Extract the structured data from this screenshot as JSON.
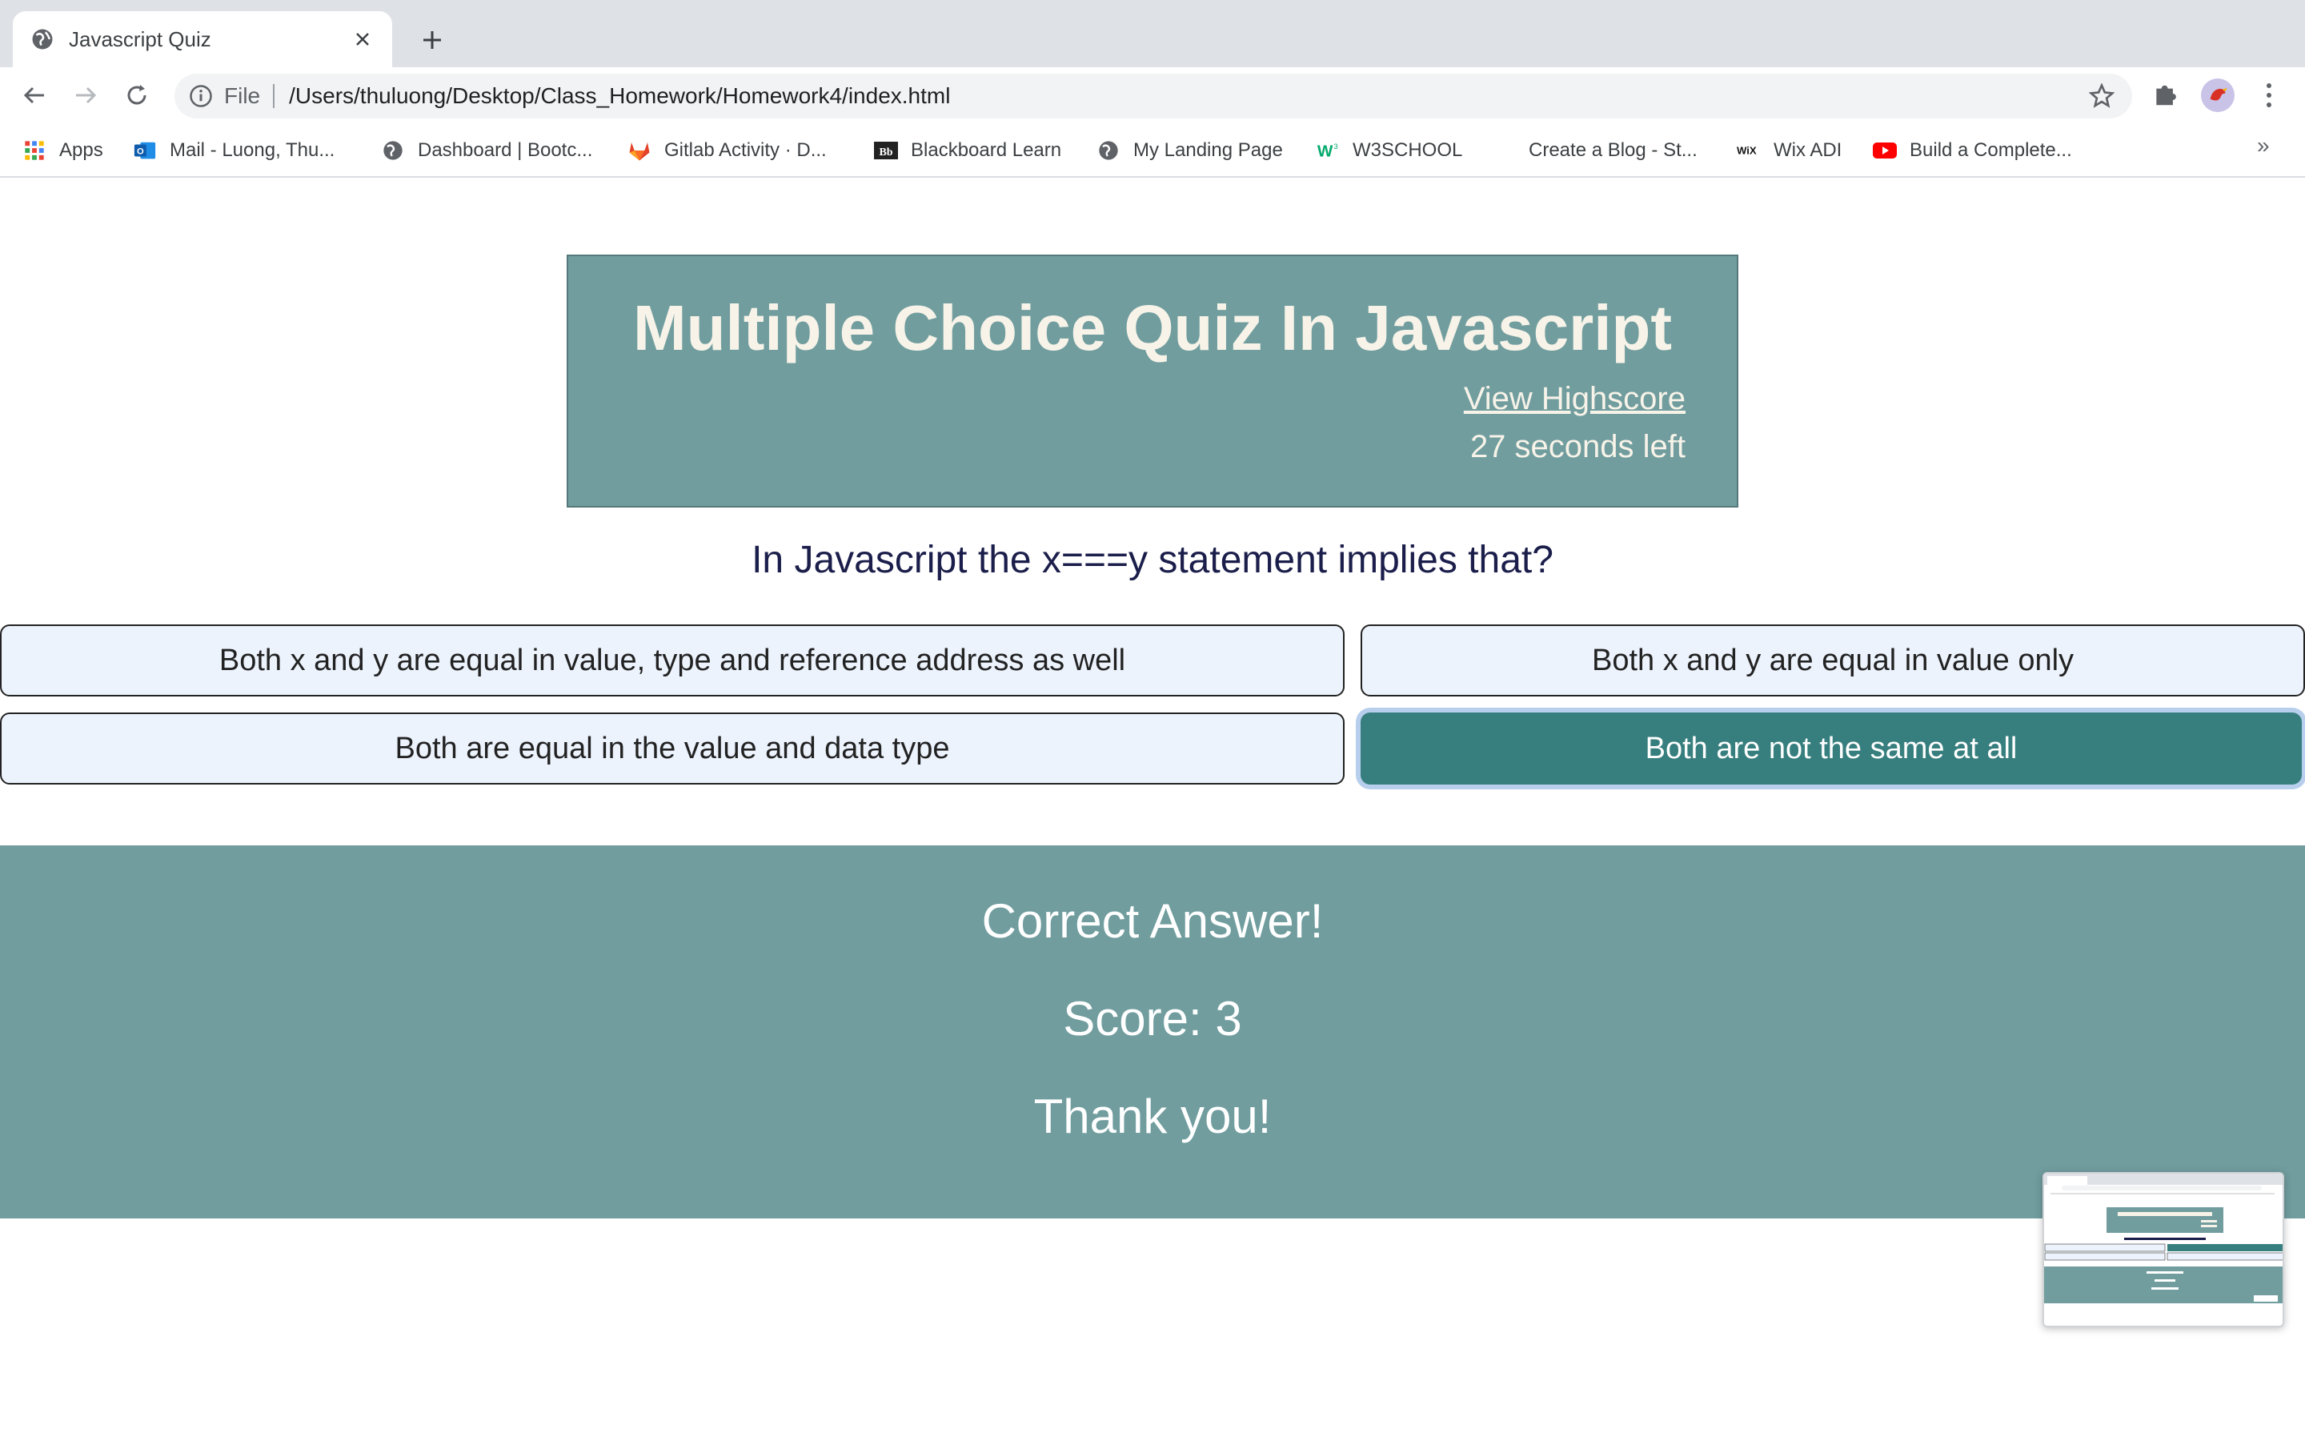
{
  "browser": {
    "tab_title": "Javascript Quiz",
    "url_scheme": "File",
    "url": "/Users/thuluong/Desktop/Class_Homework/Homework4/index.html",
    "bookmarks": [
      {
        "label": "Apps",
        "icon": "apps-grid-icon"
      },
      {
        "label": "Mail - Luong, Thu...",
        "icon": "outlook-icon"
      },
      {
        "label": "Dashboard | Bootc...",
        "icon": "globe-icon"
      },
      {
        "label": "Gitlab Activity · D...",
        "icon": "gitlab-icon"
      },
      {
        "label": "Blackboard Learn",
        "icon": "blackboard-icon"
      },
      {
        "label": "My Landing Page",
        "icon": "globe-icon"
      },
      {
        "label": "W3SCHOOL",
        "icon": "w3schools-icon"
      },
      {
        "label": "Create a Blog - St...",
        "icon": "blank"
      },
      {
        "label": "Wix ADI",
        "icon": "wix-icon"
      },
      {
        "label": "Build a Complete...",
        "icon": "youtube-icon"
      }
    ],
    "bookmarks_overflow": "»"
  },
  "quiz": {
    "title": "Multiple Choice Quiz In Javascript",
    "highscore_link": "View Highscore",
    "timer_text": "27 seconds left",
    "question": "In Javascript the x===y statement implies that?",
    "answers": [
      "Both x and y are equal in value, type and reference address as well",
      "Both x and y are equal in value only",
      "Both are equal in the value and data type",
      "Both are not the same at all"
    ],
    "selected_answer_index": 3,
    "result": "Correct Answer!",
    "score": "Score: 3",
    "closing": "Thank you!"
  },
  "colors": {
    "header_bg": "#719d9f",
    "answer_bg": "#ecf3fd",
    "answer_selected_bg": "#377f7e",
    "result_panel_bg": "#719d9f",
    "title_text": "#f7f3e8",
    "question_text": "#1b1e4a"
  }
}
